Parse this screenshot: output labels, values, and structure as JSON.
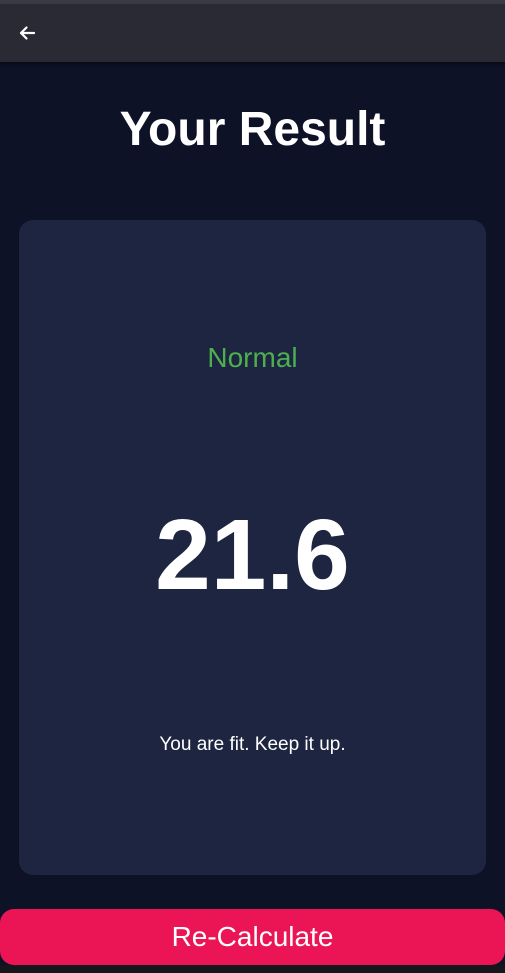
{
  "colors": {
    "background": "#0d1226",
    "app_bar": "#2a2a35",
    "card": "#1e2540",
    "status_normal": "#4caf50",
    "accent": "#eb1555",
    "text": "#ffffff"
  },
  "app_bar": {
    "back_icon": "arrow-left-icon"
  },
  "page": {
    "title": "Your Result"
  },
  "result": {
    "status": "Normal",
    "bmi": "21.6",
    "message": "You are fit. Keep it up."
  },
  "actions": {
    "recalculate_label": "Re-Calculate"
  }
}
